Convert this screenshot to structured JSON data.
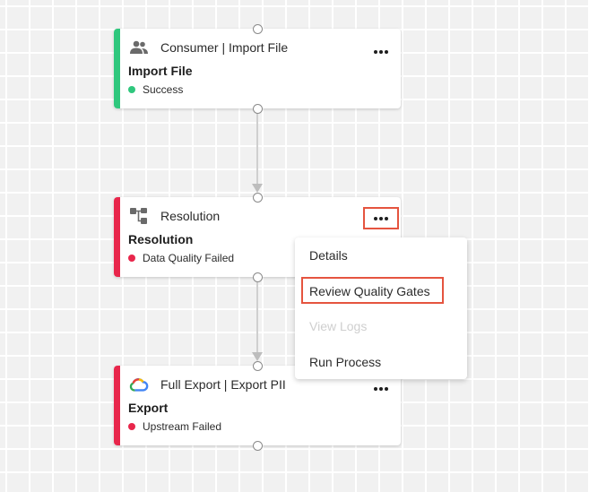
{
  "colors": {
    "success": "#2fc77d",
    "failed": "#e8264b",
    "highlight": "#e5543f"
  },
  "nodes": [
    {
      "icon": "users-icon",
      "title": "Consumer | Import File",
      "name": "Import File",
      "status": "Success",
      "status_color": "#2fc77d"
    },
    {
      "icon": "workflow-icon",
      "title": "Resolution",
      "name": "Resolution",
      "status": "Data Quality Failed",
      "status_color": "#e8264b"
    },
    {
      "icon": "google-cloud-icon",
      "title": "Full Export | Export PII",
      "name": "Export",
      "status": "Upstream Failed",
      "status_color": "#e8264b"
    }
  ],
  "menu": {
    "items": [
      {
        "label": "Details",
        "enabled": true
      },
      {
        "label": "Review Quality Gates",
        "enabled": true
      },
      {
        "label": "View Logs",
        "enabled": false
      },
      {
        "label": "Run Process",
        "enabled": true
      }
    ]
  }
}
